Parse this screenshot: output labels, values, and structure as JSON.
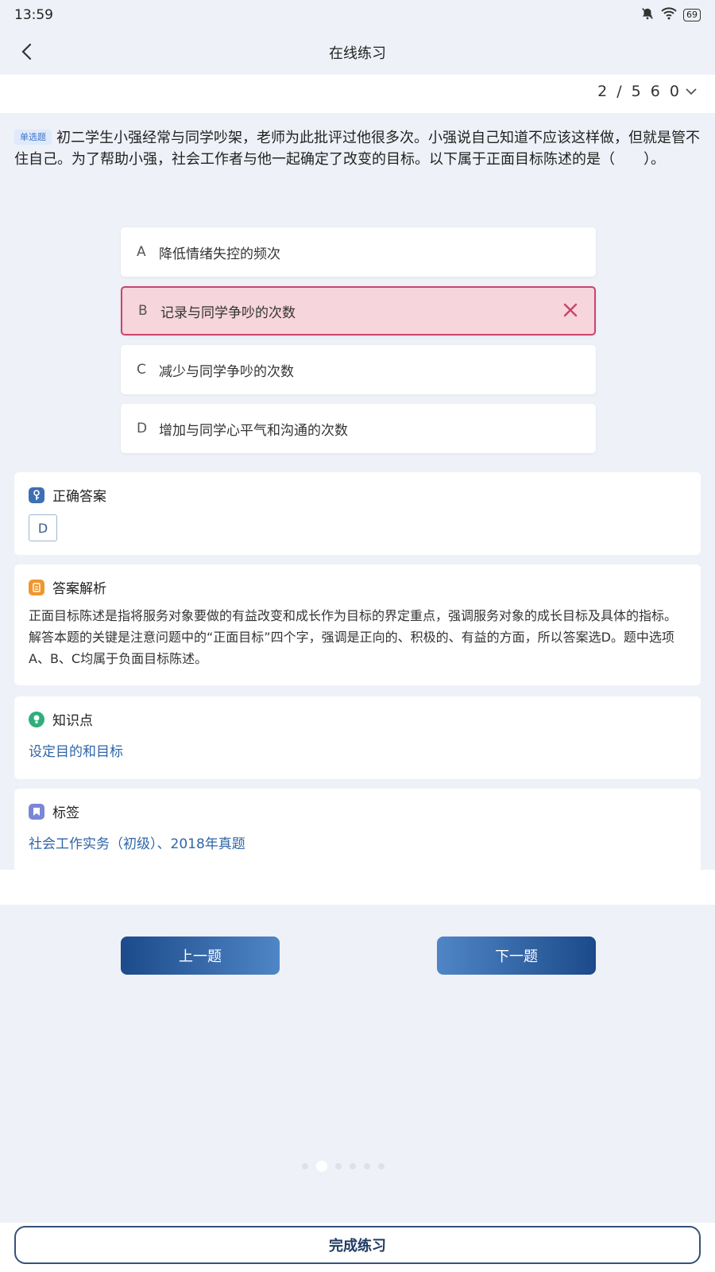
{
  "status": {
    "time": "13:59",
    "battery": "69"
  },
  "header": {
    "title": "在线练习"
  },
  "progress": {
    "label": "2 / 5 6 0"
  },
  "question": {
    "type_badge": "单选题",
    "text": "初二学生小强经常与同学吵架，老师为此批评过他很多次。小强说自己知道不应该这样做，但就是管不住自己。为了帮助小强，社会工作者与他一起确定了改变的目标。以下属于正面目标陈述的是（　　）。"
  },
  "options": [
    {
      "letter": "A",
      "text": "降低情绪失控的频次",
      "state": "normal"
    },
    {
      "letter": "B",
      "text": "记录与同学争吵的次数",
      "state": "wrong"
    },
    {
      "letter": "C",
      "text": "减少与同学争吵的次数",
      "state": "normal"
    },
    {
      "letter": "D",
      "text": "增加与同学心平气和沟通的次数",
      "state": "normal"
    }
  ],
  "correct_answer": {
    "title": "正确答案",
    "value": "D"
  },
  "analysis": {
    "title": "答案解析",
    "text": "正面目标陈述是指将服务对象要做的有益改变和成长作为目标的界定重点，强调服务对象的成长目标及具体的指标。解答本题的关键是注意问题中的“正面目标”四个字，强调是正向的、积极的、有益的方面，所以答案选D。题中选项A、B、C均属于负面目标陈述。"
  },
  "knowledge": {
    "title": "知识点",
    "value": "设定目的和目标"
  },
  "tags": {
    "title": "标签",
    "value": "社会工作实务（初级）、2018年真题"
  },
  "nav": {
    "prev_label": "上一题",
    "next_label": "下一题"
  },
  "footer": {
    "finish_label": "完成练习"
  },
  "colors": {
    "accent": "#2f66a8",
    "wrong_bg": "#f6d5dc",
    "wrong_border": "#c9456b",
    "key_icon": "#3d6fb3",
    "analysis_icon": "#f0962e",
    "knowledge_icon": "#2fae7a",
    "tag_icon": "#7b86d6"
  }
}
